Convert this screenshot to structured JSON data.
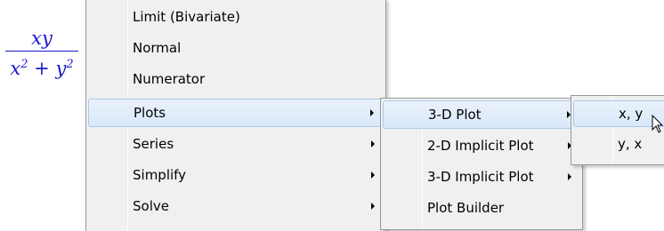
{
  "expression": {
    "numerator": "xy",
    "denominator_base1": "x",
    "denominator_exp1": "2",
    "denominator_plus": " + ",
    "denominator_base2": "y",
    "denominator_exp2": "2"
  },
  "context_menu": {
    "items": [
      {
        "label": "Limit (Bivariate)",
        "has_submenu": false
      },
      {
        "label": "Normal",
        "has_submenu": false
      },
      {
        "label": "Numerator",
        "has_submenu": false
      },
      {
        "label": "Plots",
        "has_submenu": true,
        "highlighted": true
      },
      {
        "label": "Series",
        "has_submenu": true
      },
      {
        "label": "Simplify",
        "has_submenu": true
      },
      {
        "label": "Solve",
        "has_submenu": true
      }
    ]
  },
  "plots_submenu": {
    "items": [
      {
        "label": "3-D Plot",
        "has_submenu": true,
        "highlighted": true
      },
      {
        "label": "2-D Implicit Plot",
        "has_submenu": true
      },
      {
        "label": "3-D Implicit Plot",
        "has_submenu": true
      },
      {
        "label": "Plot Builder",
        "has_submenu": false
      }
    ]
  },
  "plot3d_submenu": {
    "items": [
      {
        "label": "x, y",
        "highlighted": true
      },
      {
        "label": "y, x"
      }
    ]
  },
  "colors": {
    "math_blue": "#1a1acd",
    "highlight_border": "#a8c8ee",
    "menu_bg": "#f0f0f0"
  }
}
